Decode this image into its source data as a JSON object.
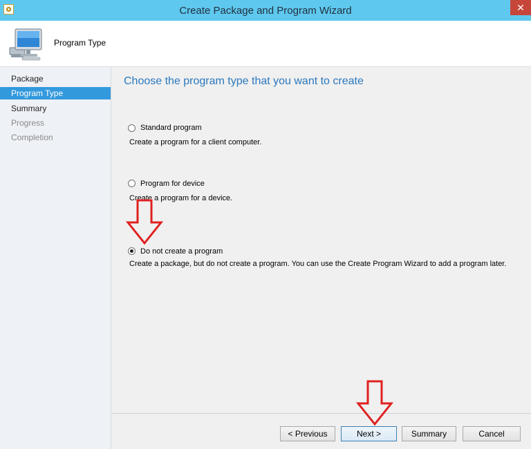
{
  "window": {
    "title": "Create Package and Program Wizard",
    "close_label": "✕"
  },
  "header": {
    "title": "Program Type"
  },
  "nav": {
    "items": [
      {
        "label": "Package",
        "state": "done"
      },
      {
        "label": "Program Type",
        "state": "current"
      },
      {
        "label": "Summary",
        "state": "done"
      },
      {
        "label": "Progress",
        "state": "future"
      },
      {
        "label": "Completion",
        "state": "future"
      }
    ]
  },
  "main": {
    "heading": "Choose the program type that you want to create",
    "options": [
      {
        "label": "Standard program",
        "description": "Create a program for a client computer.",
        "selected": false
      },
      {
        "label": "Program for device",
        "description": "Create a program for a device.",
        "selected": false
      },
      {
        "label": "Do not create a program",
        "description": "Create a package, but do not create a program. You can use the Create Program Wizard to add a program later.",
        "selected": true
      }
    ]
  },
  "buttons": {
    "previous": "< Previous",
    "next": "Next >",
    "summary": "Summary",
    "cancel": "Cancel"
  },
  "colors": {
    "titlebar": "#5fc8ee",
    "nav_selected": "#3399dd",
    "heading": "#2a78bd",
    "annotation_arrow": "#e02020"
  }
}
